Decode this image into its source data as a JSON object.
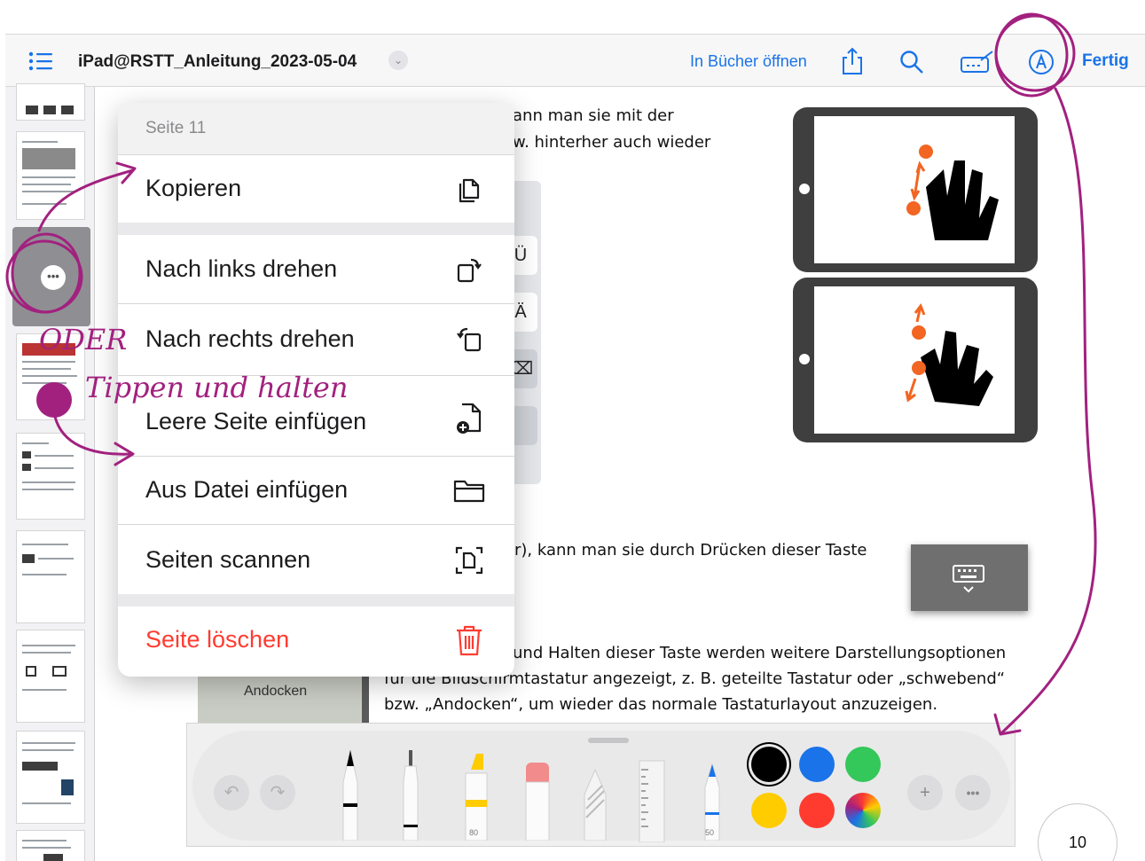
{
  "header": {
    "doc_title": "iPad@RSTT_Anleitung_2023-05-04",
    "open_in_books": "In Bücher öffnen",
    "done": "Fertig"
  },
  "content": {
    "line1": "ann man sie mit der",
    "line2": "w. hinterher auch wieder",
    "line3": "r), kann man sie durch Drücken dieser Taste",
    "line4": "und Halten dieser Taste werden weitere Darstellungsoptionen",
    "line5": "für die Bildschirmtastatur angezeigt, z. B. geteilte Tastatur oder „schwebend“",
    "line6": "bzw. „Andocken“, um wieder das normale Tastaturlayout anzuzeigen.",
    "keys": [
      "Ü",
      "Ä"
    ],
    "andocken": "Andocken"
  },
  "menu": {
    "header": "Seite 11",
    "items": [
      {
        "label": "Kopieren",
        "icon": "copy-icon"
      },
      {
        "label": "Nach links drehen",
        "icon": "rotate-left-icon"
      },
      {
        "label": "Nach rechts drehen",
        "icon": "rotate-right-icon"
      },
      {
        "label": "Leere Seite einfügen",
        "icon": "insert-blank-page-icon"
      },
      {
        "label": "Aus Datei einfügen",
        "icon": "folder-icon"
      },
      {
        "label": "Seiten scannen",
        "icon": "scan-icon"
      },
      {
        "label": "Seite löschen",
        "icon": "trash-icon"
      }
    ],
    "delete_color": "#ff3b30"
  },
  "annotation": {
    "oder": "ODER",
    "tippen": "Tippen und halten",
    "ink_color": "#a2217f"
  },
  "tools": {
    "marker_value": "80",
    "pencil_value": "50",
    "colors": [
      "#000000",
      "#1a73e8",
      "#34c759",
      "#ffcc00",
      "#ff3b30"
    ]
  },
  "page_number": "10"
}
